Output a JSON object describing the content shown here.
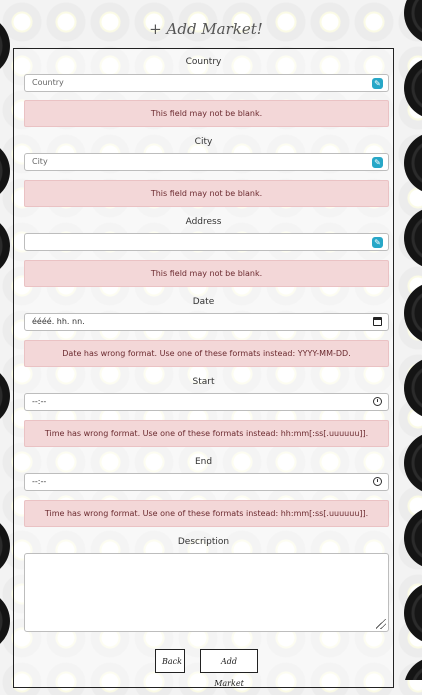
{
  "page": {
    "title": "+ Add Market!"
  },
  "form": {
    "country": {
      "label": "Country",
      "placeholder": "Country",
      "error": "This field may not be blank."
    },
    "city": {
      "label": "City",
      "placeholder": "City",
      "error": "This field may not be blank."
    },
    "address": {
      "label": "Address",
      "placeholder": "",
      "error": "This field may not be blank."
    },
    "date": {
      "label": "Date",
      "value": "éééé. hh. nn.",
      "error": "Date has wrong format. Use one of these formats instead: YYYY-MM-DD."
    },
    "start": {
      "label": "Start",
      "value": "--:--",
      "error": "Time has wrong format. Use one of these formats instead: hh:mm[:ss[.uuuuuu]]."
    },
    "end": {
      "label": "End",
      "value": "--:--",
      "error": "Time has wrong format. Use one of these formats instead: hh:mm[:ss[.uuuuuu]]."
    },
    "description": {
      "label": "Description",
      "value": ""
    }
  },
  "buttons": {
    "back": "Back",
    "add_market": "Add Market"
  },
  "icons": {
    "field_badge": "pen-icon",
    "date": "calendar-icon",
    "time": "clock-icon"
  },
  "colors": {
    "error_bg": "#f3d7d8",
    "error_text": "#6b2a2f",
    "badge": "#27a7c7",
    "vinyl_label": "#e1d234"
  }
}
